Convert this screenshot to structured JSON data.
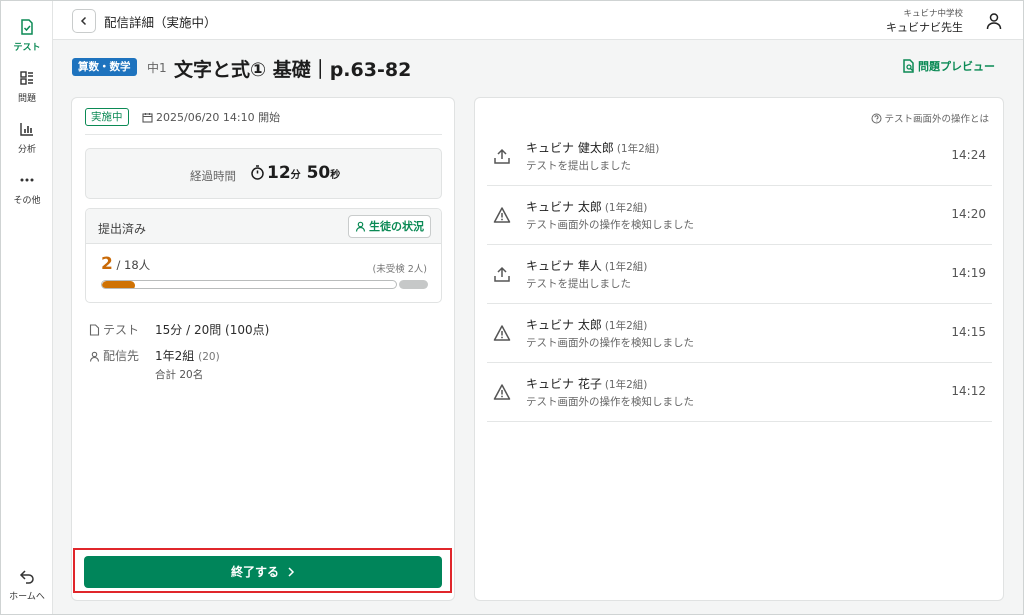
{
  "sidebar": {
    "items": [
      {
        "label": "テスト",
        "icon": "test-icon"
      },
      {
        "label": "問題",
        "icon": "questions-icon"
      },
      {
        "label": "分析",
        "icon": "analysis-icon"
      },
      {
        "label": "その他",
        "icon": "more-icon"
      }
    ],
    "home_label": "ホームへ"
  },
  "header": {
    "title": "配信詳細（実施中）",
    "school": "キュビナ中学校",
    "teacher": "キュビナビ先生"
  },
  "page": {
    "subject": "算数・数学",
    "grade": "中1",
    "title": "文字と式① 基礎｜p.63-82",
    "preview_label": "問題プレビュー"
  },
  "summary": {
    "status": "実施中",
    "start": "2025/06/20 14:10 開始",
    "elapsed_label": "経過時間",
    "elapsed_min": "12",
    "elapsed_min_unit": "分",
    "elapsed_sec": "50",
    "elapsed_sec_unit": "秒",
    "submitted_label": "提出済み",
    "student_status_label": "生徒の状況",
    "submitted_count": "2",
    "submitted_total": " / 18人",
    "untaken": "(未受検 2人)",
    "progress_fraction": 0.111,
    "test_label": "テスト",
    "test_value": "15分 / 20問 (100点)",
    "target_label": "配信先",
    "target_value": "1年2組",
    "target_count": "(20)",
    "total": "合計 20名",
    "end_label": "終了する"
  },
  "log": {
    "help_label": "テスト画面外の操作とは",
    "items": [
      {
        "name": "キュビナ 健太郎",
        "class": "(1年2組)",
        "desc": "テストを提出しました",
        "time": "14:24",
        "icon": "upload-icon"
      },
      {
        "name": "キュビナ 太郎",
        "class": "(1年2組)",
        "desc": "テスト画面外の操作を検知しました",
        "time": "14:20",
        "icon": "warning-icon"
      },
      {
        "name": "キュビナ 隼人",
        "class": "(1年2組)",
        "desc": "テストを提出しました",
        "time": "14:19",
        "icon": "upload-icon"
      },
      {
        "name": "キュビナ 太郎",
        "class": "(1年2組)",
        "desc": "テスト画面外の操作を検知しました",
        "time": "14:15",
        "icon": "warning-icon"
      },
      {
        "name": "キュビナ 花子",
        "class": "(1年2組)",
        "desc": "テスト画面外の操作を検知しました",
        "time": "14:12",
        "icon": "warning-icon"
      }
    ]
  },
  "colors": {
    "accent": "#00855a",
    "progress": "#cf7204",
    "subject_badge": "#1e73be",
    "highlight_outline": "#e0262b"
  }
}
